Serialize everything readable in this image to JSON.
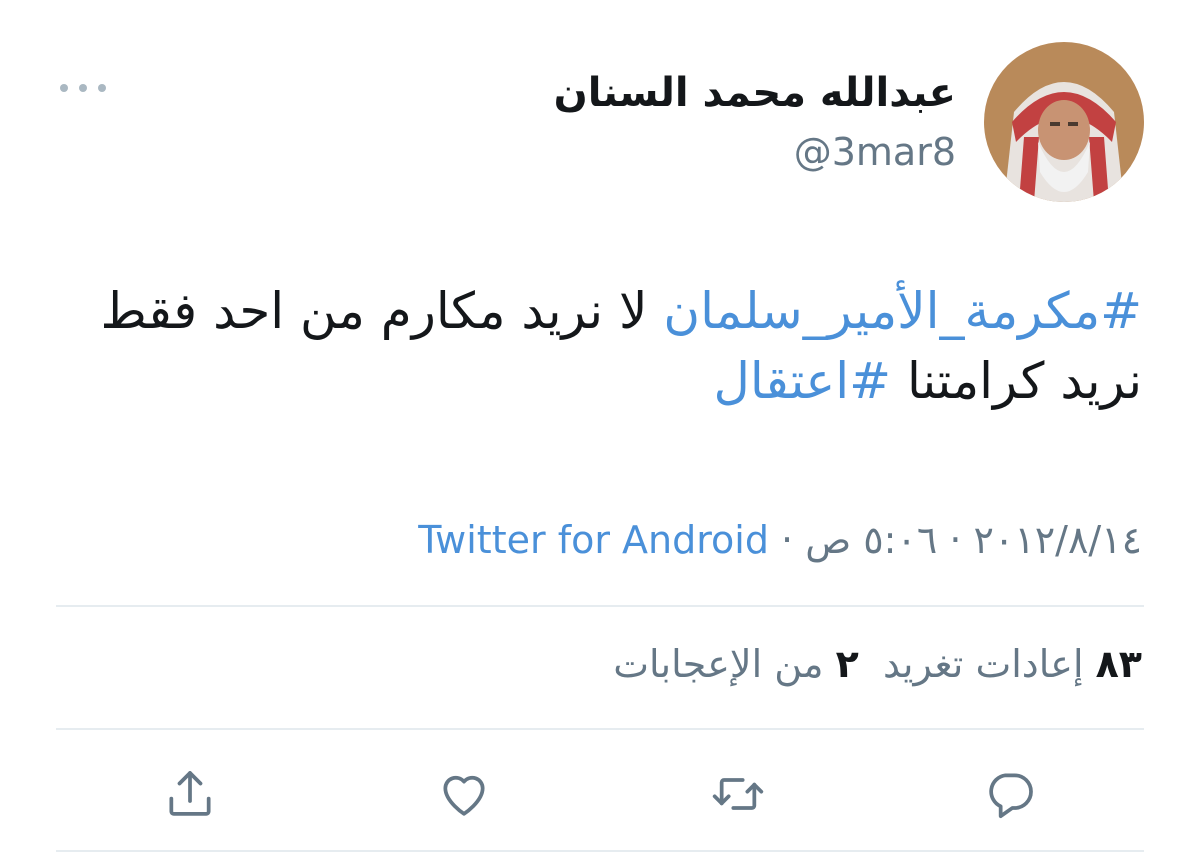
{
  "tweet": {
    "author": {
      "display_name": "عبدالله محمد السنان",
      "handle": "@3mar8"
    },
    "text": {
      "hashtag_1": "#مكرمة_الأمير_سلمان",
      "body": " لا نريد مكارم من احد فقط نريد كرامتنا ",
      "hashtag_2": "#اعتقال"
    },
    "meta": {
      "date": "٢٠١٢/٨/١٤",
      "time": "٥:٠٦ ص",
      "separator": " · ",
      "source": "Twitter for Android"
    },
    "stats": {
      "retweets_count": "٨٣",
      "retweets_label": "إعادات تغريد",
      "likes_count": "٢",
      "likes_label": "من الإعجابات"
    }
  },
  "icons": {
    "more": "more-dots-icon",
    "reply": "reply-icon",
    "retweet": "retweet-icon",
    "like": "heart-icon",
    "share": "share-icon"
  },
  "colors": {
    "link": "#4a90d9",
    "muted": "#657786",
    "text": "#14171a",
    "divider": "#e6ecf0"
  }
}
